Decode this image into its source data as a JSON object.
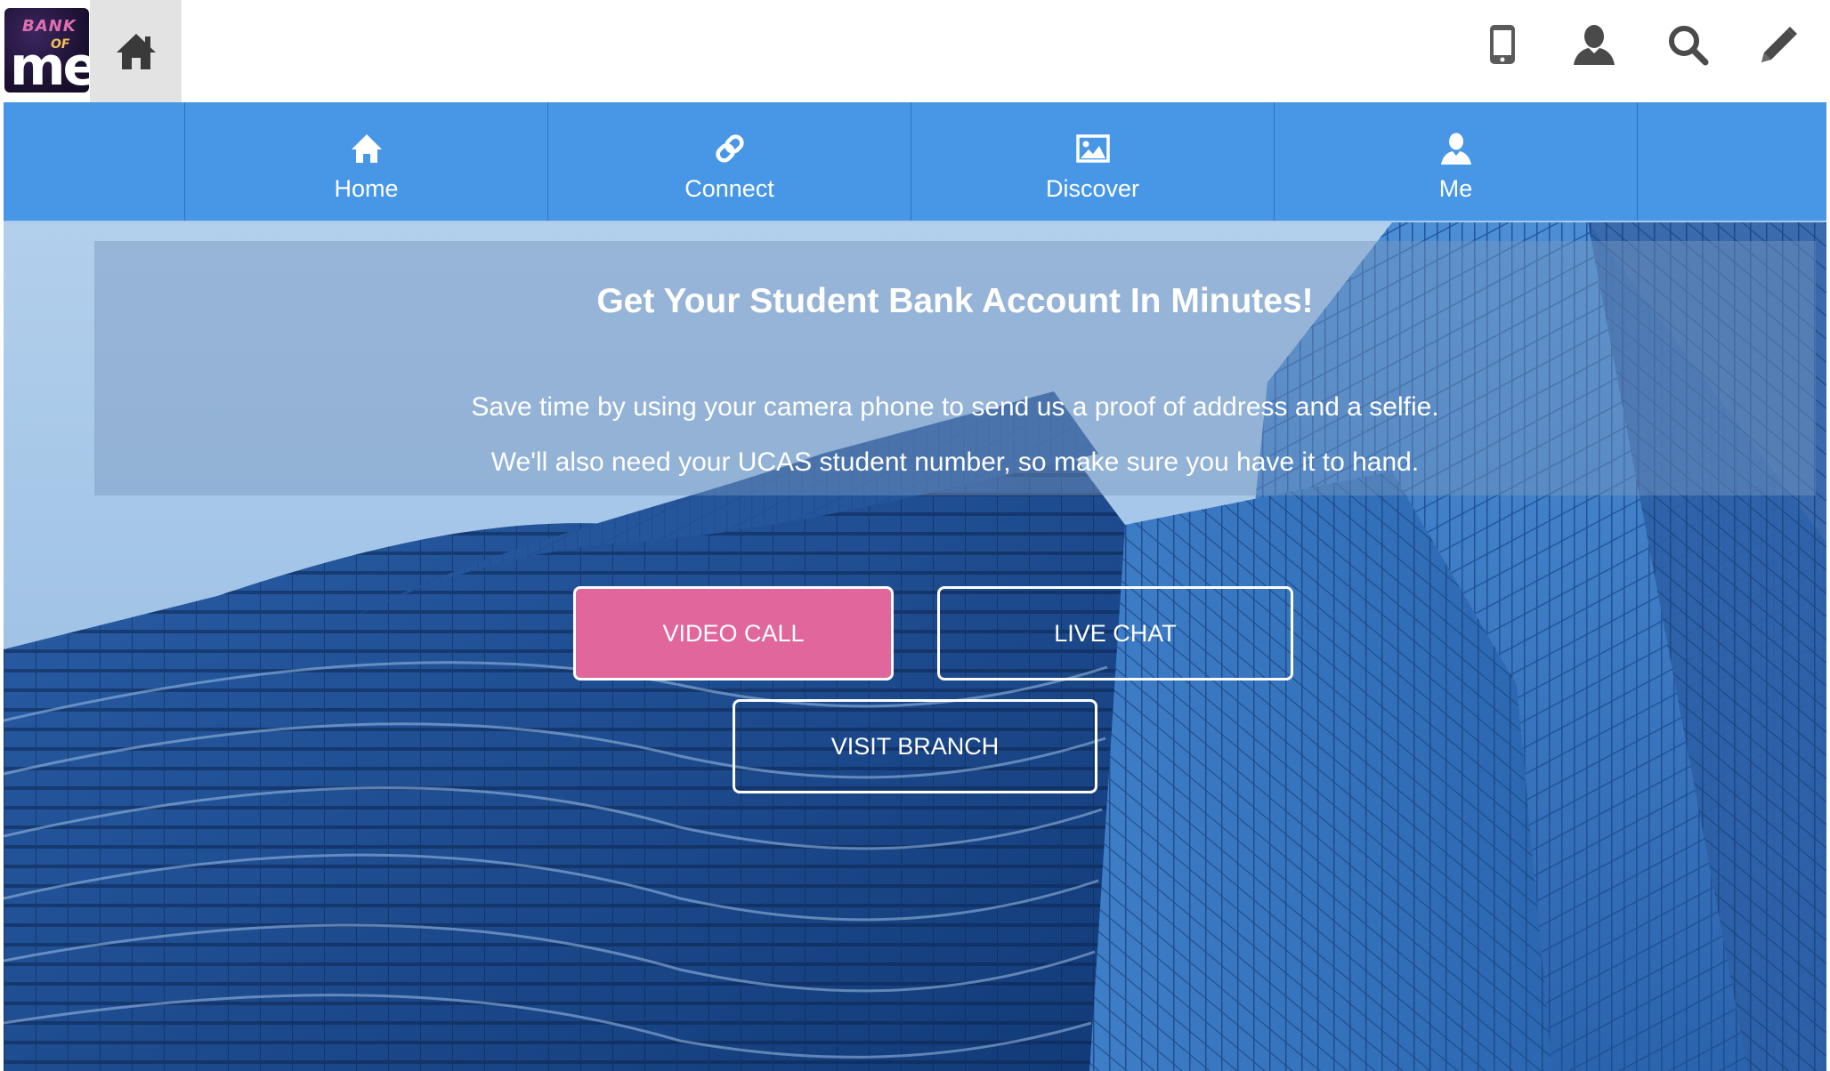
{
  "brand": {
    "logo_text_bank": "BANK",
    "logo_text_of": "OF",
    "logo_text_me": "me"
  },
  "topbar": {
    "icons": [
      "home-icon",
      "mobile-icon",
      "user-icon",
      "search-icon",
      "pencil-icon"
    ]
  },
  "nav": {
    "items": [
      {
        "label": "Home",
        "icon": "home-icon"
      },
      {
        "label": "Connect",
        "icon": "link-icon"
      },
      {
        "label": "Discover",
        "icon": "image-icon"
      },
      {
        "label": "Me",
        "icon": "user-icon"
      }
    ]
  },
  "hero": {
    "headline": "Get Your Student Bank Account In Minutes!",
    "line1": "Save time by using your camera phone to send us a proof of address and a selfie.",
    "line2": "We'll also need your UCAS student number, so make sure you have it to hand.",
    "buttons": {
      "video_call": "VIDEO CALL",
      "live_chat": "LIVE CHAT",
      "visit_branch": "VISIT BRANCH"
    }
  },
  "colors": {
    "nav_blue": "#4797e6",
    "primary_pink": "#e0669b",
    "logo_bg": "#1d1233"
  }
}
